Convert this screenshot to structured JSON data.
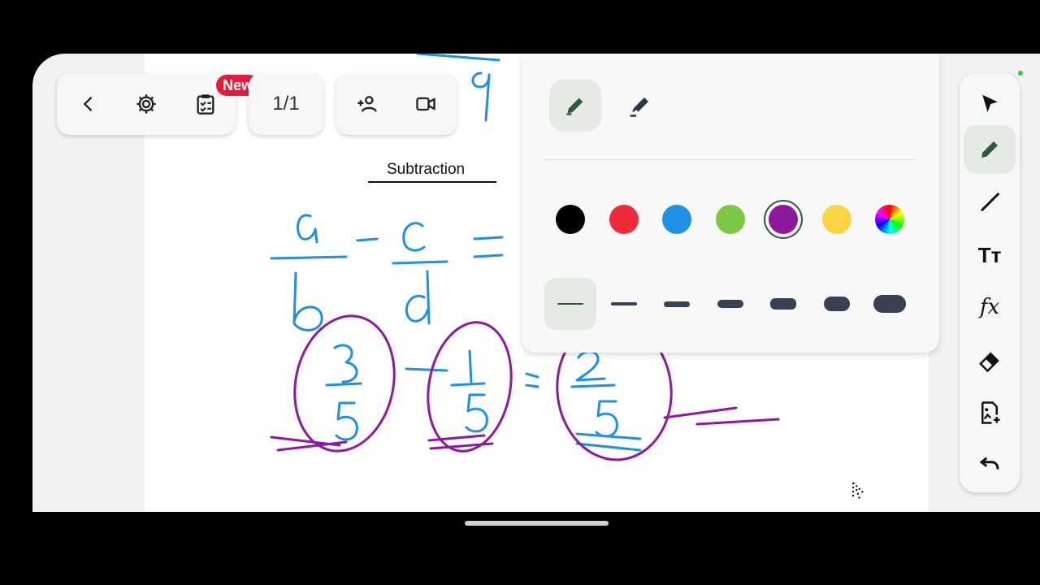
{
  "top_bar": {
    "back_icon": "chevron-left-icon",
    "settings_icon": "gear-icon",
    "clipboard_icon": "clipboard-list-icon",
    "new_badge": "New",
    "page_counter": "1/1",
    "invite_icon": "add-people-icon",
    "video_icon": "video-camera-icon"
  },
  "canvas": {
    "section_title": "Subtraction",
    "handwriting": {
      "formula": "a/b - c/d =",
      "example": "3/5 - 1/5 = 2/5",
      "partial_top": "9"
    }
  },
  "pen_panel": {
    "tools": [
      {
        "name": "pen",
        "icon": "pencil-icon",
        "active": true
      },
      {
        "name": "highlighter",
        "icon": "highlighter-icon",
        "active": false
      }
    ],
    "colors": [
      {
        "name": "black",
        "hex": "#000000",
        "selected": false
      },
      {
        "name": "red",
        "hex": "#ef2b3a",
        "selected": false
      },
      {
        "name": "blue",
        "hex": "#1e90e6",
        "selected": false
      },
      {
        "name": "green",
        "hex": "#7cc843",
        "selected": false
      },
      {
        "name": "purple",
        "hex": "#8e199e",
        "selected": true
      },
      {
        "name": "yellow",
        "hex": "#fbd443",
        "selected": false
      },
      {
        "name": "custom",
        "hex": "rainbow",
        "selected": false
      }
    ],
    "thickness_levels": [
      1,
      2,
      3,
      4,
      5,
      6,
      7
    ],
    "selected_thickness": 1
  },
  "right_toolbar": {
    "tools": [
      {
        "name": "select",
        "icon": "arrow-cursor-icon",
        "active": false
      },
      {
        "name": "pen",
        "icon": "pencil-icon",
        "active": true
      },
      {
        "name": "line",
        "icon": "line-icon",
        "active": false
      },
      {
        "name": "text",
        "icon": "text-icon",
        "label": "Tт",
        "active": false
      },
      {
        "name": "formula",
        "icon": "function-icon",
        "label": "fx",
        "active": false
      },
      {
        "name": "eraser",
        "icon": "eraser-icon",
        "active": false
      },
      {
        "name": "add-image",
        "icon": "image-add-icon",
        "active": false
      },
      {
        "name": "undo",
        "icon": "undo-icon",
        "active": false
      }
    ]
  },
  "colors": {
    "ink_blue": "#1e90e6",
    "ink_purple": "#8e199e",
    "accent_green": "#2f5a3c",
    "badge_red": "#e21d3b"
  }
}
